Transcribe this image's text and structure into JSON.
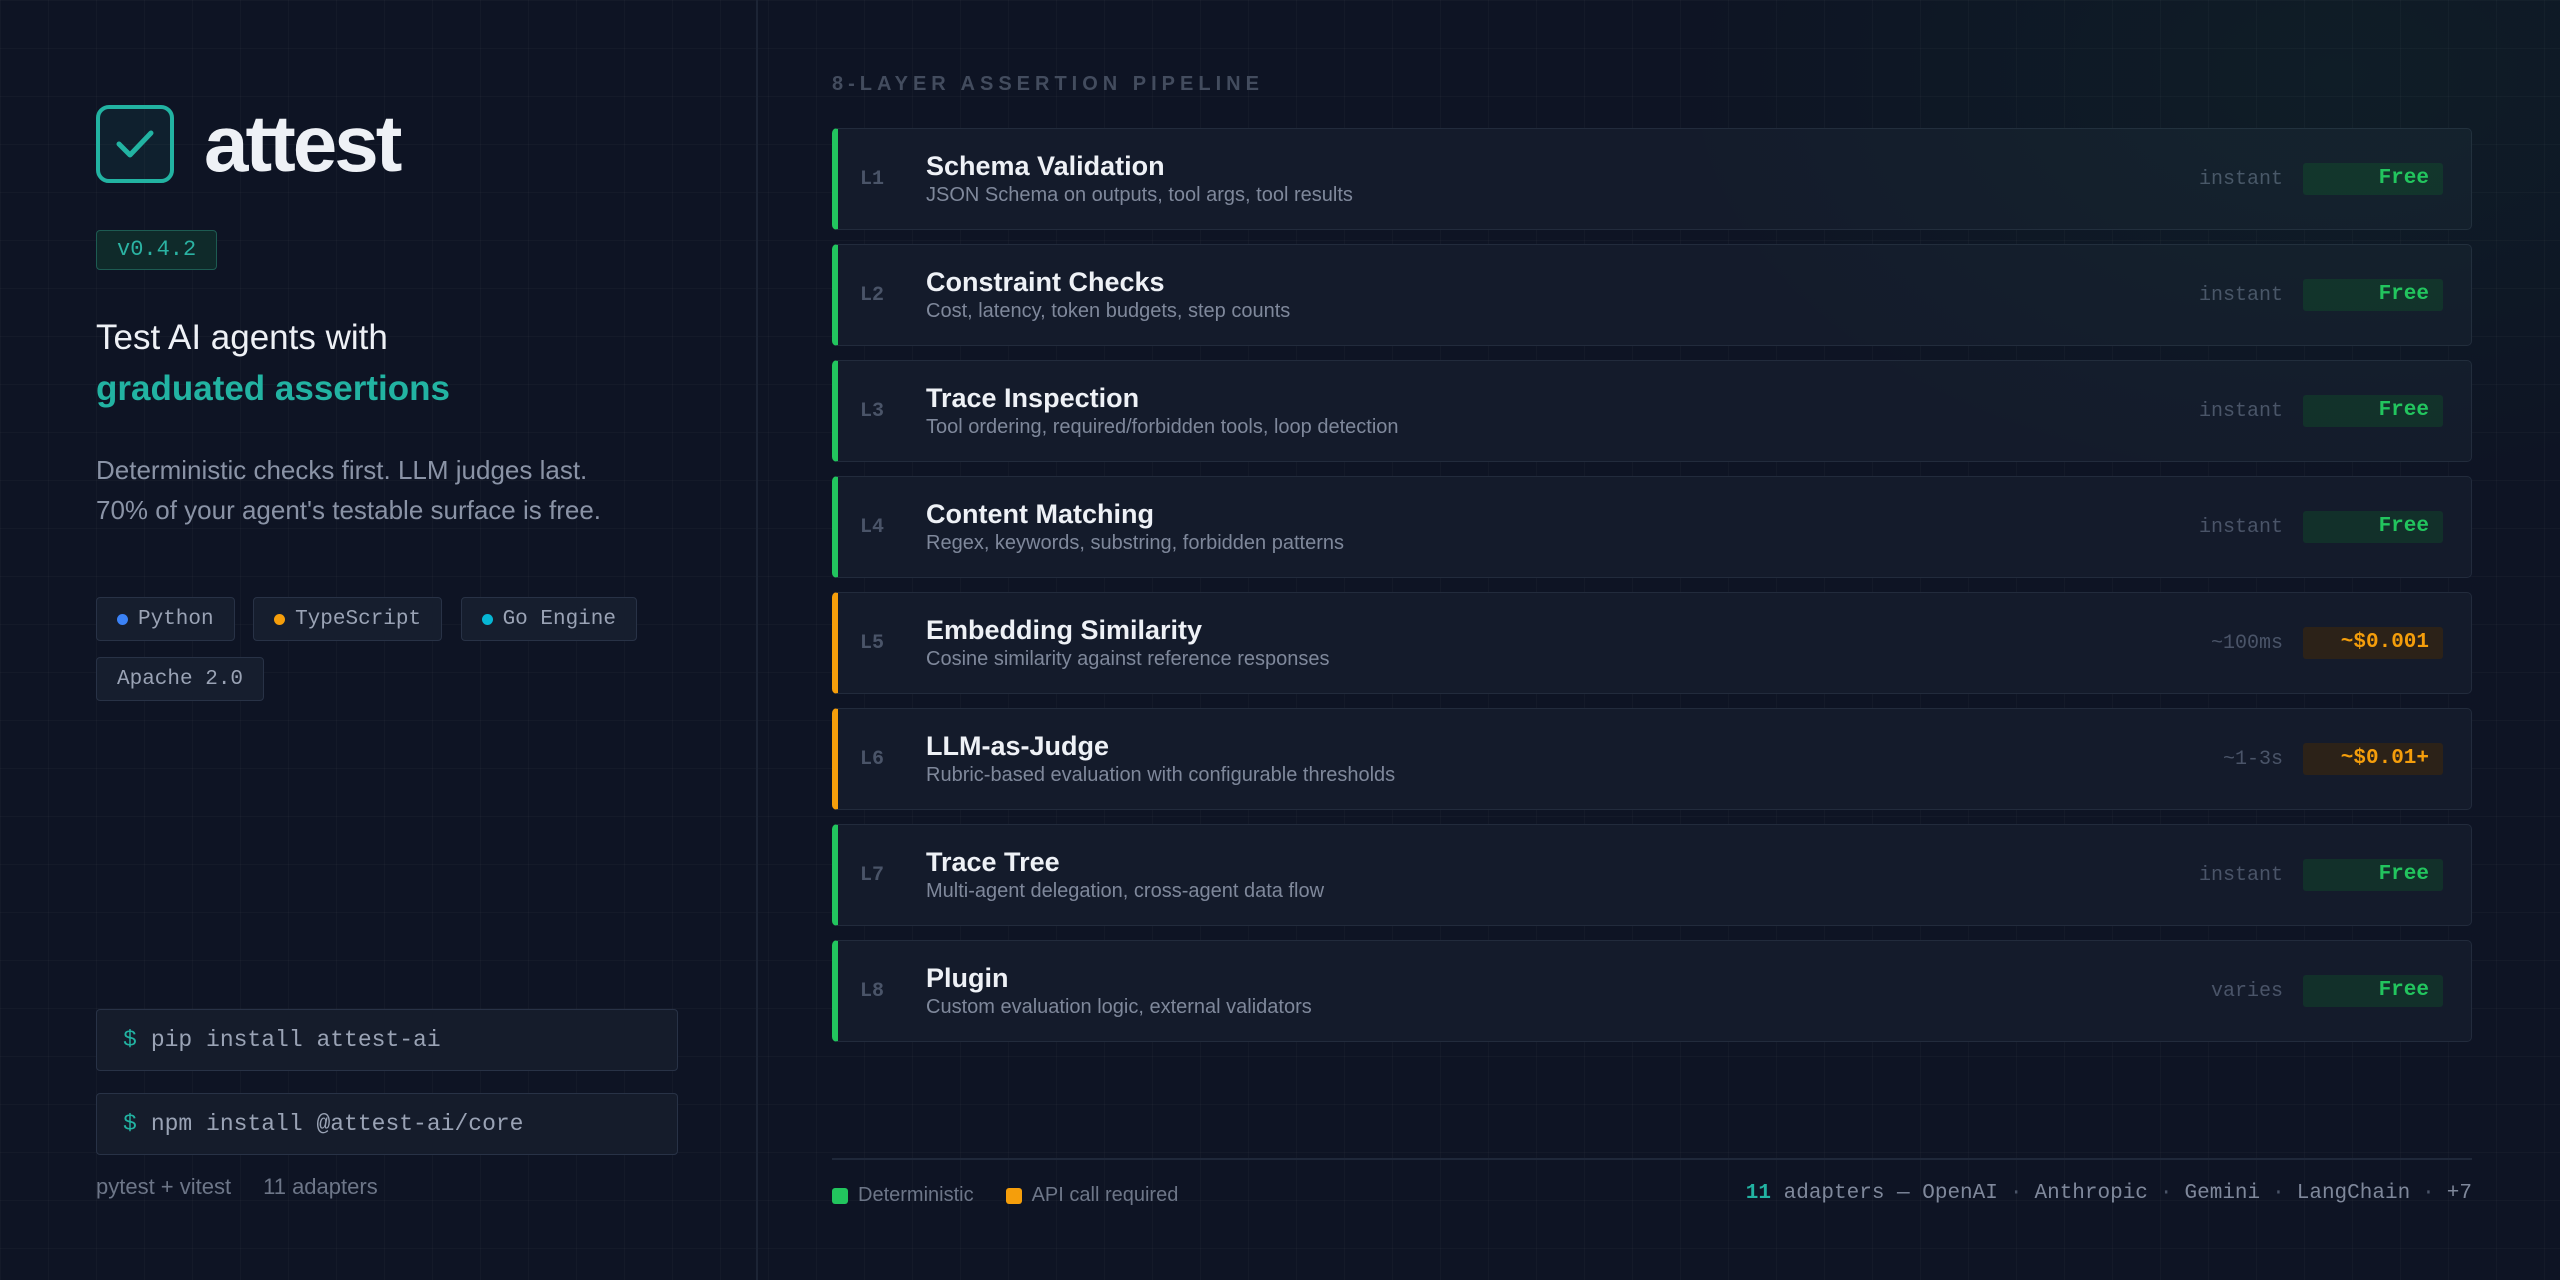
{
  "brand": {
    "name": "attest",
    "version": "v0.4.2"
  },
  "hero": {
    "headline_line1": "Test AI agents with",
    "headline_line2": "graduated assertions",
    "description_line1": "Deterministic checks first. LLM judges last.",
    "description_line2": "70% of your agent's testable surface is free."
  },
  "tags": [
    {
      "label": "Python",
      "dot_color": "#3b82f6"
    },
    {
      "label": "TypeScript",
      "dot_color": "#f59e0b"
    },
    {
      "label": "Go Engine",
      "dot_color": "#06b6d4"
    },
    {
      "label": "Apache 2.0",
      "dot_color": null
    }
  ],
  "install": {
    "prompt": "$",
    "pip": "pip install attest-ai",
    "npm": "npm install @attest-ai/core"
  },
  "footer_left": {
    "frameworks": "pytest + vitest",
    "adapters": "11 adapters"
  },
  "pipeline": {
    "title": "8-LAYER ASSERTION PIPELINE",
    "layers": [
      {
        "id": "L1",
        "name": "Schema Validation",
        "desc": "JSON Schema on outputs, tool args, tool results",
        "speed": "instant",
        "cost": "Free",
        "kind": "deterministic"
      },
      {
        "id": "L2",
        "name": "Constraint Checks",
        "desc": "Cost, latency, token budgets, step counts",
        "speed": "instant",
        "cost": "Free",
        "kind": "deterministic"
      },
      {
        "id": "L3",
        "name": "Trace Inspection",
        "desc": "Tool ordering, required/forbidden tools, loop detection",
        "speed": "instant",
        "cost": "Free",
        "kind": "deterministic"
      },
      {
        "id": "L4",
        "name": "Content Matching",
        "desc": "Regex, keywords, substring, forbidden patterns",
        "speed": "instant",
        "cost": "Free",
        "kind": "deterministic"
      },
      {
        "id": "L5",
        "name": "Embedding Similarity",
        "desc": "Cosine similarity against reference responses",
        "speed": "~100ms",
        "cost": "~$0.001",
        "kind": "api"
      },
      {
        "id": "L6",
        "name": "LLM-as-Judge",
        "desc": "Rubric-based evaluation with configurable thresholds",
        "speed": "~1-3s",
        "cost": "~$0.01+",
        "kind": "api"
      },
      {
        "id": "L7",
        "name": "Trace Tree",
        "desc": "Multi-agent delegation, cross-agent data flow",
        "speed": "instant",
        "cost": "Free",
        "kind": "deterministic"
      },
      {
        "id": "L8",
        "name": "Plugin",
        "desc": "Custom evaluation logic, external validators",
        "speed": "varies",
        "cost": "Free",
        "kind": "deterministic"
      }
    ]
  },
  "legend": {
    "deterministic": "Deterministic",
    "api": "API call required",
    "deterministic_color": "#22c55e",
    "api_color": "#f59e0b"
  },
  "adapters_line": {
    "count": "11",
    "label": "adapters —",
    "names": [
      "OpenAI",
      "Anthropic",
      "Gemini",
      "LangChain",
      "+7"
    ]
  },
  "colors": {
    "accent": "#22b3a2",
    "background": "#0e1424",
    "free": "#22c55e",
    "paid": "#f59e0b"
  }
}
